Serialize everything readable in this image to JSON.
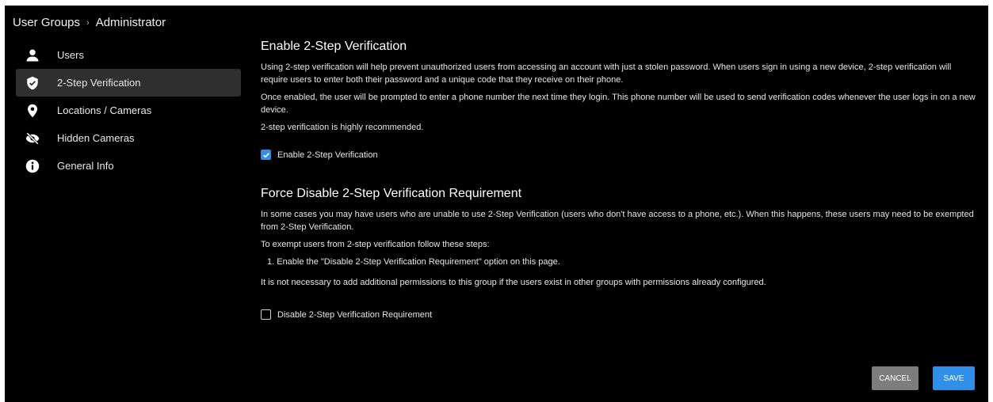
{
  "breadcrumb": {
    "parent": "User Groups",
    "separator": "›",
    "current": "Administrator"
  },
  "sidebar": {
    "items": [
      {
        "label": "Users",
        "icon": "user-icon",
        "active": false
      },
      {
        "label": "2-Step Verification",
        "icon": "shield-check-icon",
        "active": true
      },
      {
        "label": "Locations / Cameras",
        "icon": "map-pin-icon",
        "active": false
      },
      {
        "label": "Hidden Cameras",
        "icon": "eye-off-icon",
        "active": false
      },
      {
        "label": "General Info",
        "icon": "info-icon",
        "active": false
      }
    ]
  },
  "main": {
    "enable_section": {
      "title": "Enable 2-Step Verification",
      "para1": "Using 2-step verification will help prevent unauthorized users from accessing an account with just a stolen password. When users sign in using a new device, 2-step verification will require users to enter both their password and a unique code that they receive on their phone.",
      "para2": "Once enabled, the user will be prompted to enter a phone number the next time they login. This phone number will be used to send verification codes whenever the user logs in on a new device.",
      "para3": "2-step verification is highly recommended.",
      "checkbox_label": "Enable 2-Step Verification",
      "checkbox_checked": true
    },
    "disable_section": {
      "title": "Force Disable 2-Step Verification Requirement",
      "para1": "In some cases you may have users who are unable to use 2-Step Verification (users who don't have access to a phone, etc.). When this happens, these users may need to be exempted from 2-Step Verification.",
      "para2": "To exempt users from 2-step verification follow these steps:",
      "step1": "1. Enable the \"Disable 2-Step Verification Requirement\" option on this page.",
      "para3": "It is not necessary to add additional permissions to this group if the users exist in other groups with permissions already configured.",
      "checkbox_label": "Disable 2-Step Verification Requirement",
      "checkbox_checked": false
    }
  },
  "buttons": {
    "cancel": "CANCEL",
    "save": "SAVE"
  },
  "colors": {
    "background": "#000000",
    "accent": "#2f8fe9",
    "active_item": "#2f2f2f",
    "cancel_button": "#7d7d7d"
  }
}
